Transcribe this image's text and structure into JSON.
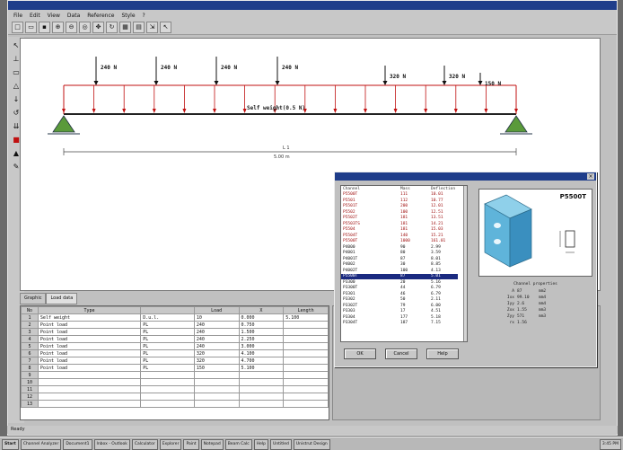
{
  "menu": [
    "File",
    "Edit",
    "View",
    "Data",
    "Reference",
    "Style",
    "?"
  ],
  "toolbar_icons": [
    "new-icon",
    "open-icon",
    "save-icon",
    "zoom-in-icon",
    "zoom-out-icon",
    "zoom-fit-icon",
    "pan-icon",
    "refresh-icon",
    "table-icon",
    "print-icon",
    "export-icon",
    "pointer-icon"
  ],
  "left_tools": [
    "select-icon",
    "node-icon",
    "beam-icon",
    "support-icon",
    "load-icon",
    "moment-icon",
    "distributed-load-icon",
    "color-icon",
    "dimension-icon",
    "probe-icon"
  ],
  "beam": {
    "loads": [
      "240 N",
      "240 N",
      "240 N",
      "240 N",
      "320 N",
      "320 N",
      "150 N"
    ],
    "udl_label": "Self weight(0.5 N)",
    "span_label": "L 1",
    "span_value": "5.00 m"
  },
  "tabs": [
    "Graphic",
    "Load data"
  ],
  "grid": {
    "headers": [
      "No",
      "Type",
      "",
      "Load",
      "X",
      "Length"
    ],
    "rows": [
      [
        "1",
        "Self weight",
        "D.u.l.",
        "10",
        "0.000",
        "5.100"
      ],
      [
        "2",
        "Point load",
        "PL",
        "240",
        "0.750",
        ""
      ],
      [
        "3",
        "Point load",
        "PL",
        "240",
        "1.500",
        ""
      ],
      [
        "4",
        "Point load",
        "PL",
        "240",
        "2.250",
        ""
      ],
      [
        "5",
        "Point load",
        "PL",
        "240",
        "3.000",
        ""
      ],
      [
        "6",
        "Point load",
        "PL",
        "320",
        "4.100",
        ""
      ],
      [
        "7",
        "Point load",
        "PL",
        "320",
        "4.700",
        ""
      ],
      [
        "8",
        "Point load",
        "PL",
        "150",
        "5.100",
        ""
      ],
      [
        "9",
        "",
        "",
        "",
        "",
        ""
      ],
      [
        "10",
        "",
        "",
        "",
        "",
        ""
      ],
      [
        "11",
        "",
        "",
        "",
        "",
        ""
      ],
      [
        "12",
        "",
        "",
        "",
        "",
        ""
      ],
      [
        "13",
        "",
        "",
        "",
        "",
        ""
      ]
    ]
  },
  "dialog": {
    "list_headers": [
      "Channel",
      "Mass",
      "Deflection"
    ],
    "items": [
      {
        "name": "P5500T",
        "mass": "111",
        "defl": "10.01",
        "red": true
      },
      {
        "name": "P5501",
        "mass": "112",
        "defl": "10.77",
        "red": true
      },
      {
        "name": "P5501T",
        "mass": "200",
        "defl": "12.01",
        "red": true
      },
      {
        "name": "P5502",
        "mass": "100",
        "defl": "12.51",
        "red": true
      },
      {
        "name": "P5502T",
        "mass": "181",
        "defl": "13.51",
        "red": true
      },
      {
        "name": "P5503TS",
        "mass": "181",
        "defl": "14.21",
        "red": true
      },
      {
        "name": "P5504",
        "mass": "181",
        "defl": "15.03",
        "red": true
      },
      {
        "name": "P5504T",
        "mass": "140",
        "defl": "15.21",
        "red": true
      },
      {
        "name": "P5500T",
        "mass": "1000",
        "defl": "161.01",
        "red": true
      },
      {
        "name": "P4000",
        "mass": "90",
        "defl": "2.99",
        "red": false
      },
      {
        "name": "P4001",
        "mass": "80",
        "defl": "3.59",
        "red": false
      },
      {
        "name": "P4001T",
        "mass": "87",
        "defl": "8.01",
        "red": false
      },
      {
        "name": "P4002",
        "mass": "30",
        "defl": "8.85",
        "red": false
      },
      {
        "name": "P4002T",
        "mass": "100",
        "defl": "4.13",
        "red": false
      },
      {
        "name": "P5500T",
        "mass": "87",
        "defl": "5.01",
        "red": false,
        "selected": true
      },
      {
        "name": "P3300",
        "mass": "20",
        "defl": "5.16",
        "red": false
      },
      {
        "name": "P3300T",
        "mass": "44",
        "defl": "6.79",
        "red": false
      },
      {
        "name": "P3301",
        "mass": "46",
        "defl": "6.79",
        "red": false
      },
      {
        "name": "P3302",
        "mass": "50",
        "defl": "2.11",
        "red": false
      },
      {
        "name": "P3302T",
        "mass": "79",
        "defl": "6.00",
        "red": false
      },
      {
        "name": "P3303",
        "mass": "17",
        "defl": "4.51",
        "red": false
      },
      {
        "name": "P3304",
        "mass": "177",
        "defl": "5.18",
        "red": false
      },
      {
        "name": "P3304T",
        "mass": "187",
        "defl": "7.15",
        "red": false
      }
    ],
    "profile_name": "P5500T",
    "props_title": "Channel properties",
    "props": [
      [
        "A",
        "87",
        "mm2"
      ],
      [
        "Ixx",
        "99.10",
        "mm4"
      ],
      [
        "Iyy",
        "2.6",
        "mm4"
      ],
      [
        "Zxx",
        "1.55",
        "mm3"
      ],
      [
        "Zyy",
        "571",
        "mm3"
      ],
      [
        "rx",
        "1.56",
        ""
      ]
    ],
    "buttons": [
      "OK",
      "Cancel",
      "Help"
    ]
  },
  "status": "Ready",
  "taskbar": [
    "Start",
    "Channel Analyzer",
    "Document1",
    "Inbox - Outlook",
    "Calculator",
    "Explorer",
    "Paint",
    "Notepad",
    "Beam Calc",
    "Help",
    "Untitled",
    "Unistrut Design",
    "3:45 PM"
  ]
}
